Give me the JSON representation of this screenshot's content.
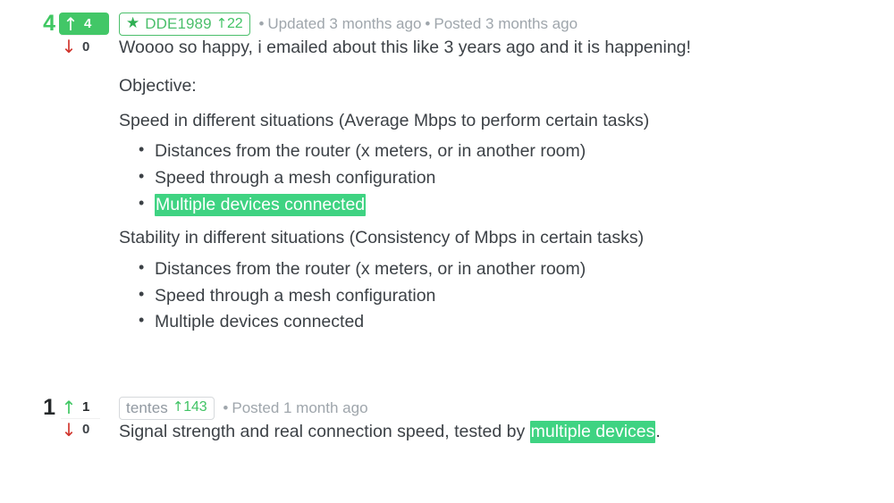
{
  "theme": {
    "vote_green": "#42c767",
    "badge_green": "#4bbf6b",
    "rep_green": "#41c365",
    "downvote_red": "#d0342c",
    "highlight_green": "#3fd382",
    "body_text": "#3c4146",
    "meta_gray": "#9fa6ac"
  },
  "comments": [
    {
      "total_score": "4",
      "upvotes": "4",
      "downvotes": "0",
      "up_arrow_icon": "arrow-up-icon",
      "down_arrow_icon": "arrow-down-icon",
      "author": {
        "star_icon": "star-icon",
        "name": "DDE1989",
        "reputation": "22",
        "rep_arrow_icon": "arrow-up-icon"
      },
      "meta": {
        "bullet": "•",
        "updated": "Updated 3 months ago",
        "separator": "•",
        "posted": "Posted 3 months ago"
      },
      "lead": "Woooo so happy, i emailed about this like 3 years ago and it is happening!",
      "objective_label": "Objective:",
      "sections": [
        {
          "heading": "Speed in different situations (Average Mbps to perform certain tasks)",
          "items": [
            {
              "text": "Distances from the router (x meters, or in another room)",
              "highlight": false
            },
            {
              "text": "Speed through a mesh configuration",
              "highlight": false
            },
            {
              "text": "Multiple devices connected",
              "highlight": true
            }
          ]
        },
        {
          "heading": "Stability in different situations (Consistency of Mbps in certain tasks)",
          "items": [
            {
              "text": "Distances from the router (x meters, or in another room)",
              "highlight": false
            },
            {
              "text": "Speed through a mesh configuration",
              "highlight": false
            },
            {
              "text": "Multiple devices connected",
              "highlight": false
            }
          ]
        }
      ]
    },
    {
      "total_score": "1",
      "upvotes": "1",
      "downvotes": "0",
      "up_arrow_icon": "arrow-up-icon",
      "down_arrow_icon": "arrow-down-icon",
      "author": {
        "name": "tentes",
        "reputation": "143",
        "rep_arrow_icon": "arrow-up-icon"
      },
      "meta": {
        "bullet": "•",
        "posted": "Posted 1 month ago"
      },
      "body_before": "Signal strength and real connection speed, tested by ",
      "body_highlight": "multiple devices",
      "body_after": "."
    }
  ],
  "glyphs": {
    "arrow_up": "↑",
    "arrow_down": "↓",
    "star": "★"
  }
}
